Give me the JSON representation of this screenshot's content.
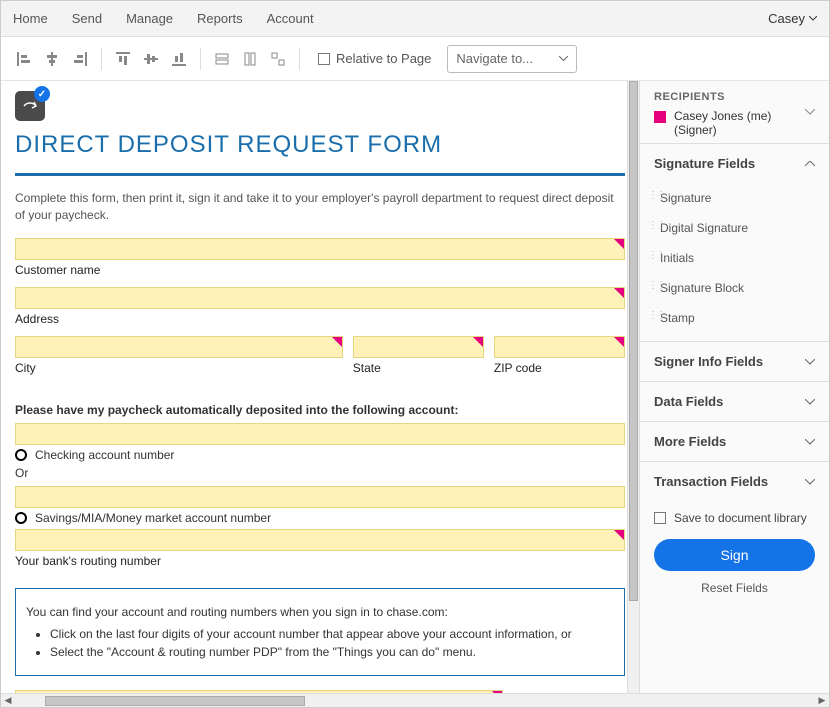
{
  "topnav": {
    "items": [
      "Home",
      "Send",
      "Manage",
      "Reports",
      "Account"
    ],
    "user": "Casey"
  },
  "toolbar": {
    "relative": "Relative to Page",
    "navigate": "Navigate to..."
  },
  "doc": {
    "title": "DIRECT DEPOSIT REQUEST FORM",
    "intro": "Complete this form, then print it, sign it and take it to your employer's payroll department to request direct deposit of your paycheck.",
    "labels": {
      "customer": "Customer name",
      "address": "Address",
      "city": "City",
      "state": "State",
      "zip": "ZIP code"
    },
    "section": "Please have my paycheck automatically deposited into the following account:",
    "checking": "Checking account number",
    "or": "Or",
    "savings": "Savings/MIA/Money market account number",
    "routing": "Your bank's routing number",
    "info": {
      "lead": "You can find your account and routing numbers when you sign in to chase.com:",
      "b1": "Click on the last four digits of your account number that appear above your account information, or",
      "b2": "Select the \"Account & routing number PDP\" from the \"Things you can do\" menu."
    }
  },
  "side": {
    "recipients": "RECIPIENTS",
    "signer": {
      "name": "Casey Jones (me)",
      "role": "(Signer)"
    },
    "sigfields": {
      "title": "Signature Fields",
      "items": [
        "Signature",
        "Digital Signature",
        "Initials",
        "Signature Block",
        "Stamp"
      ]
    },
    "sections": [
      "Signer Info Fields",
      "Data Fields",
      "More Fields",
      "Transaction Fields"
    ],
    "savelib": "Save to document library",
    "sign": "Sign",
    "reset": "Reset Fields"
  }
}
